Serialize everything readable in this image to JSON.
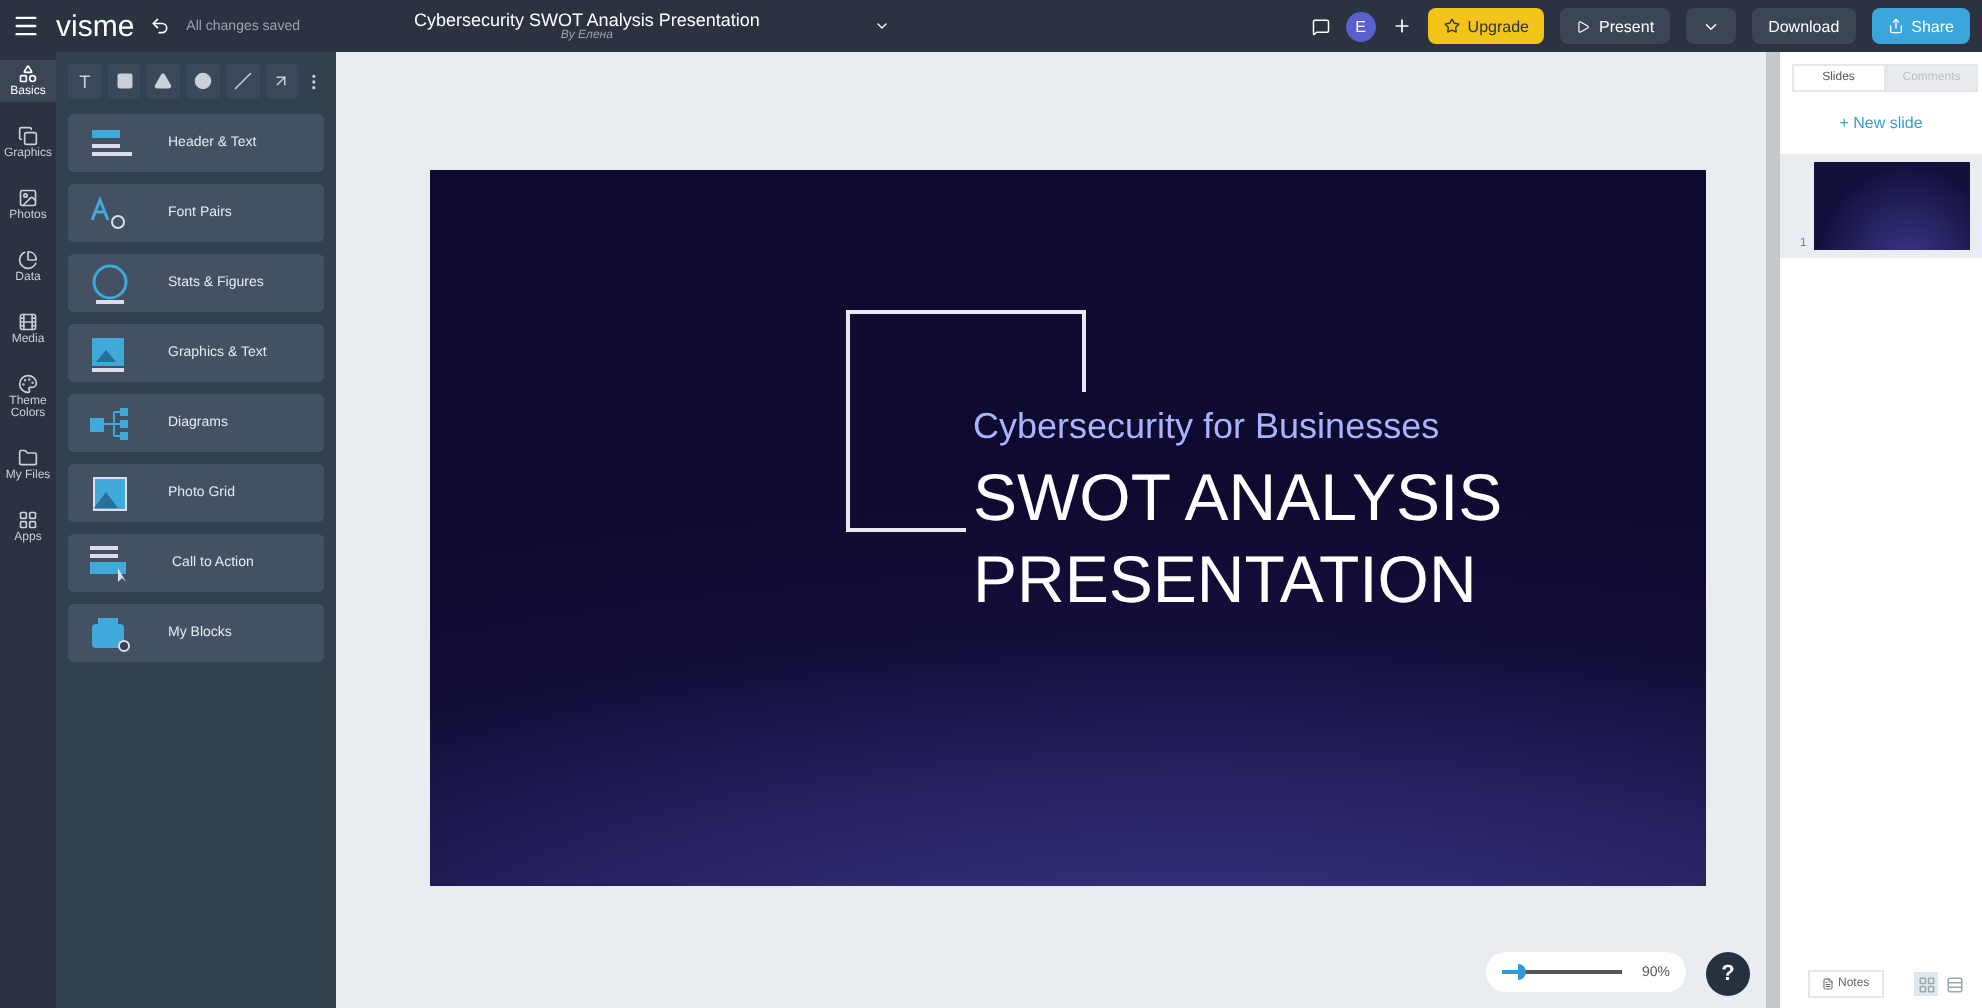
{
  "topbar": {
    "brand": "visme",
    "save_status": "All changes saved",
    "title": "Cybersecurity SWOT Analysis Presentation",
    "author": "By Елена",
    "avatar": "E",
    "upgrade": "Upgrade",
    "present": "Present",
    "download": "Download",
    "share": "Share"
  },
  "rail": [
    {
      "label": "Basics",
      "selected": true
    },
    {
      "label": "Graphics",
      "selected": false
    },
    {
      "label": "Photos",
      "selected": false
    },
    {
      "label": "Data",
      "selected": false
    },
    {
      "label": "Media",
      "selected": false
    },
    {
      "label": "Theme Colors",
      "selected": false
    },
    {
      "label": "My Files",
      "selected": false
    },
    {
      "label": "Apps",
      "selected": false
    }
  ],
  "tools": [
    "T"
  ],
  "blocks": [
    {
      "label": "Header & Text",
      "kind": "header"
    },
    {
      "label": "Font Pairs",
      "kind": "font"
    },
    {
      "label": "Stats & Figures",
      "kind": "stats"
    },
    {
      "label": "Graphics & Text",
      "kind": "graphics"
    },
    {
      "label": "Diagrams",
      "kind": "diagram"
    },
    {
      "label": "Photo Grid",
      "kind": "photo"
    },
    {
      "label": "Call to Action",
      "kind": "cta"
    },
    {
      "label": "My Blocks",
      "kind": "myblocks"
    }
  ],
  "slide": {
    "subtitle": "Cybersecurity for Businesses",
    "title_lines": [
      "SWOT ANALYSIS",
      "PRESENTATION"
    ]
  },
  "zoom": {
    "level": 0.2,
    "reading": "90%"
  },
  "help": "?",
  "side_tabs": [
    {
      "label": "Slides",
      "selected": true
    },
    {
      "label": "Comments",
      "selected": false
    }
  ],
  "new_slide": "+ New slide",
  "slides": [
    {
      "number": "1",
      "selected": true
    }
  ],
  "notes": "Notes",
  "views": [
    {
      "kind": "grid",
      "selected": true
    },
    {
      "kind": "list",
      "selected": false
    }
  ]
}
